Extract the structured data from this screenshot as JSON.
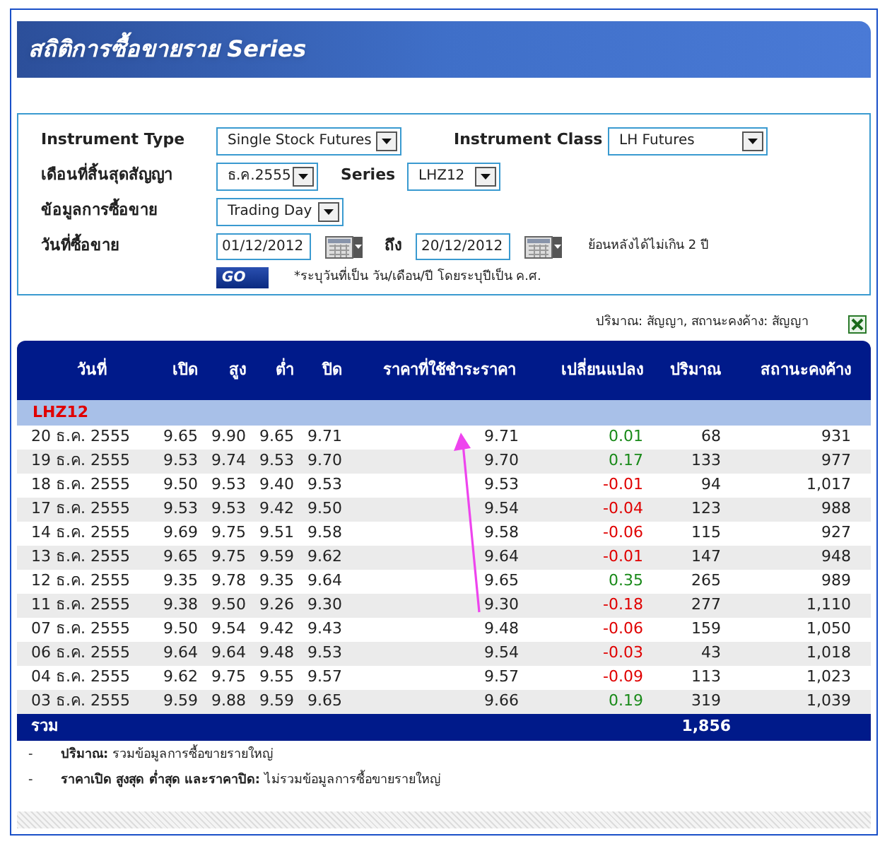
{
  "header": {
    "title": "สถิติการซื้อขายราย Series"
  },
  "form": {
    "instrument_type": {
      "label": "Instrument Type",
      "value": "Single Stock Futures"
    },
    "instrument_class": {
      "label": "Instrument Class",
      "value": "LH Futures"
    },
    "expiry_month": {
      "label": "เดือนที่สิ้นสุดสัญญา",
      "value": "ธ.ค.2555"
    },
    "series": {
      "label": "Series",
      "value": "LHZ12"
    },
    "trading_data": {
      "label": "ข้อมูลการซื้อขาย",
      "value": "Trading Day"
    },
    "trading_date": {
      "label": "วันที่ซื้อขาย",
      "from": "01/12/2012",
      "to_label": "ถึง",
      "to": "20/12/2012",
      "hint": "ย้อนหลังได้ไม่เกิน 2 ปี"
    },
    "go_button": "GO",
    "date_note": "*ระบุวันที่เป็น วัน/เดือน/ปี โดยระบุปีเป็น ค.ศ."
  },
  "units_note": "ปริมาณ: สัญญา, สถานะคงค้าง: สัญญา",
  "table": {
    "columns": [
      "วันที่",
      "เปิด",
      "สูง",
      "ต่ำ",
      "ปิด",
      "ราคาที่ใช้ชำระราคา",
      "เปลี่ยนแปลง",
      "ปริมาณ",
      "สถานะคงค้าง"
    ],
    "group": "LHZ12",
    "rows": [
      {
        "cells": [
          "20 ธ.ค. 2555",
          "9.65",
          "9.90",
          "9.65",
          "9.71",
          "9.71",
          "0.01",
          "68",
          "931"
        ],
        "color": "#1a8a1a"
      },
      {
        "cells": [
          "19 ธ.ค. 2555",
          "9.53",
          "9.74",
          "9.53",
          "9.70",
          "9.70",
          "0.17",
          "133",
          "977"
        ],
        "color": "#1a8a1a"
      },
      {
        "cells": [
          "18 ธ.ค. 2555",
          "9.50",
          "9.53",
          "9.40",
          "9.53",
          "9.53",
          "-0.01",
          "94",
          "1,017"
        ],
        "color": "#e00000"
      },
      {
        "cells": [
          "17 ธ.ค. 2555",
          "9.53",
          "9.53",
          "9.42",
          "9.50",
          "9.54",
          "-0.04",
          "123",
          "988"
        ],
        "color": "#e00000"
      },
      {
        "cells": [
          "14 ธ.ค. 2555",
          "9.69",
          "9.75",
          "9.51",
          "9.58",
          "9.58",
          "-0.06",
          "115",
          "927"
        ],
        "color": "#e00000"
      },
      {
        "cells": [
          "13 ธ.ค. 2555",
          "9.65",
          "9.75",
          "9.59",
          "9.62",
          "9.64",
          "-0.01",
          "147",
          "948"
        ],
        "color": "#e00000"
      },
      {
        "cells": [
          "12 ธ.ค. 2555",
          "9.35",
          "9.78",
          "9.35",
          "9.64",
          "9.65",
          "0.35",
          "265",
          "989"
        ],
        "color": "#1a8a1a"
      },
      {
        "cells": [
          "11 ธ.ค. 2555",
          "9.38",
          "9.50",
          "9.26",
          "9.30",
          "9.30",
          "-0.18",
          "277",
          "1,110"
        ],
        "color": "#e00000"
      },
      {
        "cells": [
          "07 ธ.ค. 2555",
          "9.50",
          "9.54",
          "9.42",
          "9.43",
          "9.48",
          "-0.06",
          "159",
          "1,050"
        ],
        "color": "#e00000"
      },
      {
        "cells": [
          "06 ธ.ค. 2555",
          "9.64",
          "9.64",
          "9.48",
          "9.53",
          "9.54",
          "-0.03",
          "43",
          "1,018"
        ],
        "color": "#e00000"
      },
      {
        "cells": [
          "04 ธ.ค. 2555",
          "9.62",
          "9.75",
          "9.55",
          "9.57",
          "9.57",
          "-0.09",
          "113",
          "1,023"
        ],
        "color": "#e00000"
      },
      {
        "cells": [
          "03 ธ.ค. 2555",
          "9.59",
          "9.88",
          "9.59",
          "9.65",
          "9.66",
          "0.19",
          "319",
          "1,039"
        ],
        "color": "#1a8a1a"
      }
    ],
    "total": {
      "label": "รวม",
      "volume": "1,856"
    }
  },
  "notes": [
    {
      "bullet": "-",
      "term": "ปริมาณ:",
      "text": "รวมข้อมูลการซื้อขายรายใหญ่"
    },
    {
      "bullet": "-",
      "term": "ราคาเปิด สูงสุด ต่ำสุด และราคาปิด:",
      "text": "ไม่รวมข้อมูลการซื้อขายรายใหญ่"
    }
  ]
}
